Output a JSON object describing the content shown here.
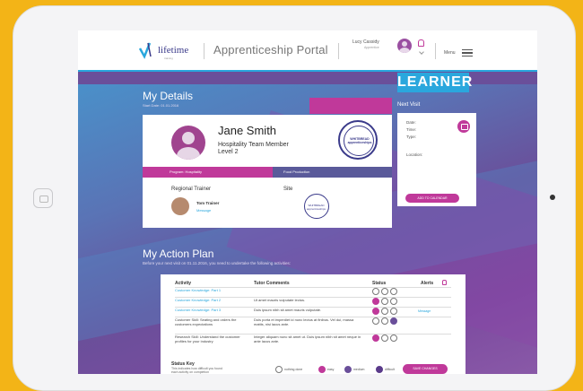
{
  "header": {
    "logo_text": "lifetime",
    "logo_sub": "training",
    "portal_title": "Apprenticeship Portal",
    "user_name": "Lucy Cassidy",
    "user_role": "Apprentice",
    "menu_label": "Menu",
    "badge": "LEARNER"
  },
  "details": {
    "title": "My Details",
    "start_date": "Start Date: 01.01.2016",
    "name": "Jane Smith",
    "role": "Hospitality Team Member",
    "level": "Level 2",
    "stamp_text": "WHITBREAD apprenticeships",
    "program_label": "Program: Hospitality",
    "program_right": "Food Production",
    "regional_trainer_title": "Regional Trainer",
    "site_title": "Site",
    "trainer_name": "Tom Trainer",
    "trainer_link": "Message",
    "site_stamp_text": "WHITBREAD apprenticeships"
  },
  "next_visit": {
    "title": "Next Visit",
    "date_label": "Date:",
    "time_label": "Time:",
    "type_label": "Type:",
    "location_label": "Location:",
    "button": "ADD TO CALENDAR"
  },
  "action_plan": {
    "title": "My Action Plan",
    "subtitle": "Before your next visit on 01.11.2016, you need to undertake the following activities:",
    "columns": [
      "Activity",
      "Tutor Comments",
      "Status",
      "Alerts"
    ],
    "rows": [
      {
        "activity": "Customer Knowledge: Part 1",
        "comment": "",
        "status": "none",
        "alert": ""
      },
      {
        "activity": "Customer Knowledge: Part 2",
        "comment": "Ut amet mauris vulputate lectus.",
        "status": "m",
        "alert": ""
      },
      {
        "activity": "Customer Knowledge: Part 3",
        "comment": "Duis ipsum nibh sit amet mauris vulputate.",
        "status": "m",
        "alert": "Message"
      },
      {
        "activity": "Customer Skill: Seating and orders the customers expectations",
        "comment": "Duis porta et imperdiet id nunc lectus at finibus. Vel dui, massa mattis, nisi lacus ante.",
        "status": "p",
        "alert": ""
      },
      {
        "activity": "Research Skill: Understand the customer profiles for your industry",
        "comment": "Integer aliquam nunc sit amet ut. Duis ipsum nibh sit amet neque in ante lacus ante.",
        "status": "m",
        "alert": ""
      }
    ],
    "key_title": "Status Key",
    "key_sub": "This indicates how difficult you found each activity on completion",
    "key_items": [
      "nothing done",
      "easy",
      "medium",
      "difficult"
    ],
    "save_button": "SAVE CHANGES"
  }
}
